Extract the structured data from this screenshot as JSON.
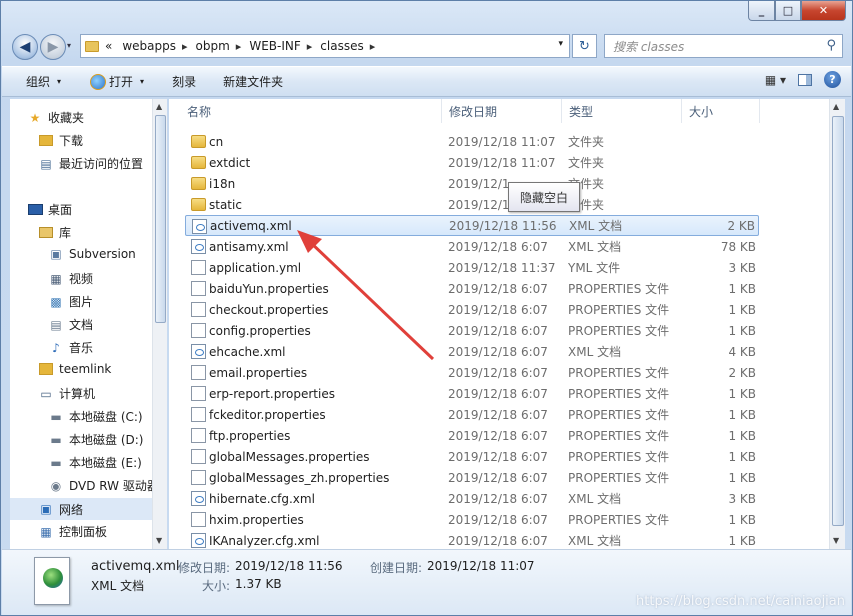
{
  "window": {
    "min": "_",
    "max": "□",
    "close": "✕"
  },
  "nav": {
    "back": "◀",
    "forward": "▶",
    "dropdown": "▾"
  },
  "address": {
    "crumbs": [
      "webapps",
      "obpm",
      "WEB-INF",
      "classes"
    ],
    "lead_sep": "«",
    "sep": "▸",
    "dropdown": "▾",
    "refresh": "↻"
  },
  "search": {
    "placeholder": "搜索 classes",
    "icon": "search-icon"
  },
  "toolbar": {
    "organize": "组织",
    "open": "打开",
    "burn": "刻录",
    "new_folder": "新建文件夹",
    "arrow": "▾",
    "view": "▦ ▾",
    "help": "?"
  },
  "sidebar": {
    "items": [
      {
        "label": "收藏夹",
        "icon": "star-icon"
      },
      {
        "label": "下载",
        "icon": "download-folder-icon"
      },
      {
        "label": "最近访问的位置",
        "icon": "recent-places-icon"
      },
      {
        "label": "桌面",
        "icon": "desktop-icon"
      },
      {
        "label": "库",
        "icon": "library-icon"
      },
      {
        "label": "Subversion",
        "icon": "subversion-icon"
      },
      {
        "label": "视频",
        "icon": "video-icon"
      },
      {
        "label": "图片",
        "icon": "picture-icon"
      },
      {
        "label": "文档",
        "icon": "document-icon"
      },
      {
        "label": "音乐",
        "icon": "music-icon"
      },
      {
        "label": "teemlink",
        "icon": "user-folder-icon"
      },
      {
        "label": "计算机",
        "icon": "computer-icon"
      },
      {
        "label": "本地磁盘 (C:)",
        "icon": "disk-icon"
      },
      {
        "label": "本地磁盘 (D:)",
        "icon": "disk-icon"
      },
      {
        "label": "本地磁盘 (E:)",
        "icon": "disk-icon"
      },
      {
        "label": "DVD RW 驱动器",
        "icon": "dvd-icon"
      },
      {
        "label": "网络",
        "icon": "network-icon"
      },
      {
        "label": "控制面板",
        "icon": "control-panel-icon"
      }
    ]
  },
  "columns": {
    "name": "名称",
    "date": "修改日期",
    "type": "类型",
    "size": "大小"
  },
  "files": [
    {
      "name": "cn",
      "date": "2019/12/18 11:07",
      "type": "文件夹",
      "size": "",
      "kind": "folder"
    },
    {
      "name": "extdict",
      "date": "2019/12/18 11:07",
      "type": "文件夹",
      "size": "",
      "kind": "folder"
    },
    {
      "name": "i18n",
      "date": "2019/12/1",
      "type": "文件夹",
      "size": "",
      "kind": "folder"
    },
    {
      "name": "static",
      "date": "2019/12/1",
      "type": "文件夹",
      "size": "",
      "kind": "folder"
    },
    {
      "name": "activemq.xml",
      "date": "2019/12/18 11:56",
      "type": "XML 文档",
      "size": "2 KB",
      "kind": "xml",
      "selected": true
    },
    {
      "name": "antisamy.xml",
      "date": "2019/12/18 6:07",
      "type": "XML 文档",
      "size": "78 KB",
      "kind": "xml"
    },
    {
      "name": "application.yml",
      "date": "2019/12/18 11:37",
      "type": "YML 文件",
      "size": "3 KB",
      "kind": "file"
    },
    {
      "name": "baiduYun.properties",
      "date": "2019/12/18 6:07",
      "type": "PROPERTIES 文件",
      "size": "1 KB",
      "kind": "file"
    },
    {
      "name": "checkout.properties",
      "date": "2019/12/18 6:07",
      "type": "PROPERTIES 文件",
      "size": "1 KB",
      "kind": "file"
    },
    {
      "name": "config.properties",
      "date": "2019/12/18 6:07",
      "type": "PROPERTIES 文件",
      "size": "1 KB",
      "kind": "file"
    },
    {
      "name": "ehcache.xml",
      "date": "2019/12/18 6:07",
      "type": "XML 文档",
      "size": "4 KB",
      "kind": "xml"
    },
    {
      "name": "email.properties",
      "date": "2019/12/18 6:07",
      "type": "PROPERTIES 文件",
      "size": "2 KB",
      "kind": "file"
    },
    {
      "name": "erp-report.properties",
      "date": "2019/12/18 6:07",
      "type": "PROPERTIES 文件",
      "size": "1 KB",
      "kind": "file"
    },
    {
      "name": "fckeditor.properties",
      "date": "2019/12/18 6:07",
      "type": "PROPERTIES 文件",
      "size": "1 KB",
      "kind": "file"
    },
    {
      "name": "ftp.properties",
      "date": "2019/12/18 6:07",
      "type": "PROPERTIES 文件",
      "size": "1 KB",
      "kind": "file"
    },
    {
      "name": "globalMessages.properties",
      "date": "2019/12/18 6:07",
      "type": "PROPERTIES 文件",
      "size": "1 KB",
      "kind": "file"
    },
    {
      "name": "globalMessages_zh.properties",
      "date": "2019/12/18 6:07",
      "type": "PROPERTIES 文件",
      "size": "1 KB",
      "kind": "file"
    },
    {
      "name": "hibernate.cfg.xml",
      "date": "2019/12/18 6:07",
      "type": "XML 文档",
      "size": "3 KB",
      "kind": "xml"
    },
    {
      "name": "hxim.properties",
      "date": "2019/12/18 6:07",
      "type": "PROPERTIES 文件",
      "size": "1 KB",
      "kind": "file"
    },
    {
      "name": "IKAnalyzer.cfg.xml",
      "date": "2019/12/18 6:07",
      "type": "XML 文档",
      "size": "1 KB",
      "kind": "xml"
    }
  ],
  "tooltip": "隐藏空白",
  "details": {
    "name": "activemq.xml",
    "type": "XML 文档",
    "modified_label": "修改日期:",
    "modified": "2019/12/18 11:56",
    "size_label": "大小:",
    "size": "1.37 KB",
    "created_label": "创建日期:",
    "created": "2019/12/18 11:07"
  },
  "watermark": "https://blog.csdn.net/cainiaojian",
  "colors": {
    "selection": "#d6e8fb",
    "arrow": "#e0403a",
    "folder": "#e5b63b"
  }
}
